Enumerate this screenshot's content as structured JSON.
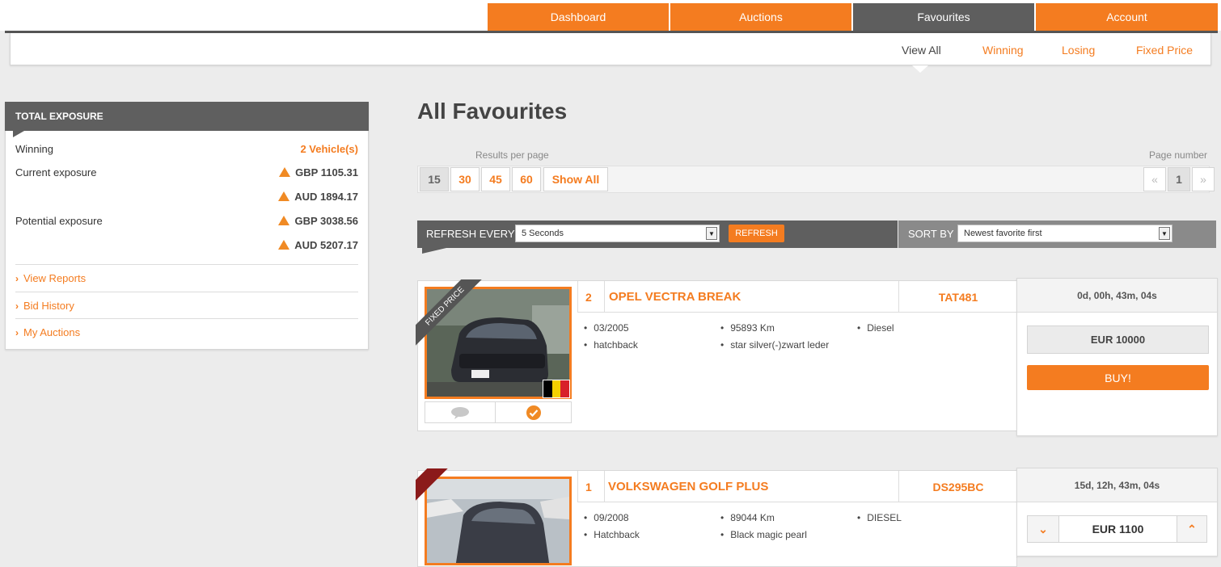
{
  "nav": {
    "tabs": [
      {
        "label": "Dashboard"
      },
      {
        "label": "Auctions"
      },
      {
        "label": "Favourites"
      },
      {
        "label": "Account"
      }
    ],
    "active": "Favourites"
  },
  "subnav": {
    "items": [
      {
        "label": "View All"
      },
      {
        "label": "Winning"
      },
      {
        "label": "Losing"
      },
      {
        "label": "Fixed Price"
      }
    ],
    "active": "View All"
  },
  "exposure": {
    "title": "TOTAL EXPOSURE",
    "winning_label": "Winning",
    "winning_value": "2 Vehicle(s)",
    "current_label": "Current exposure",
    "current_values": [
      "GBP 1105.31",
      "AUD 1894.17"
    ],
    "potential_label": "Potential exposure",
    "potential_values": [
      "GBP 3038.56",
      "AUD 5207.17"
    ],
    "links": [
      "View Reports",
      "Bid History",
      "My Auctions"
    ]
  },
  "main": {
    "title": "All Favourites",
    "results_per_page_label": "Results per page",
    "page_sizes": [
      "15",
      "30",
      "45",
      "60",
      "Show All"
    ],
    "page_number_label": "Page number",
    "pager": {
      "prev": "«",
      "current": "1",
      "next": "»"
    },
    "refresh_label": "REFRESH EVERY",
    "refresh_value": "5 Seconds",
    "refresh_button": "REFRESH",
    "sort_label": "SORT BY",
    "sort_value": "Newest favorite first"
  },
  "cars": [
    {
      "number": "2",
      "title": "OPEL VECTRA BREAK",
      "ref": "TAT481",
      "ribbon": "FIXED PRICE",
      "specs": [
        "03/2005",
        "hatchback",
        "95893 Km",
        "star silver(-)zwart leder",
        "Diesel"
      ],
      "timer": "0d, 00h, 43m, 04s",
      "price": "EUR 10000",
      "action": "BUY!"
    },
    {
      "number": "1",
      "title": "VOLKSWAGEN GOLF PLUS",
      "ref": "DS295BC",
      "specs": [
        "09/2008",
        "Hatchback",
        "89044 Km",
        "Black magic pearl",
        "DIESEL"
      ],
      "timer": "15d, 12h, 43m, 04s",
      "price": "EUR 1100",
      "stepper_down": "⌄",
      "stepper_up": "⌃"
    }
  ],
  "colors": {
    "accent": "#f47c20",
    "dark_bar": "#5f5f5f",
    "ribbon_dark": "#555555",
    "ribbon_red": "#8b1a1a"
  }
}
